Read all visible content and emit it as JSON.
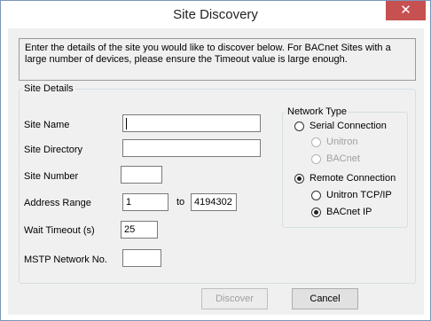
{
  "window": {
    "title": "Site Discovery",
    "close_glyph": "✕"
  },
  "intro_text": "Enter the details of the site you would like to discover below. For BACnet Sites with a large number of devices, please ensure the Timeout value is large enough.",
  "site_details": {
    "legend": "Site Details",
    "site_name": {
      "label": "Site Name",
      "value": ""
    },
    "site_directory": {
      "label": "Site Directory",
      "value": ""
    },
    "site_number": {
      "label": "Site Number",
      "value": ""
    },
    "address_range": {
      "label": "Address Range",
      "from": "1",
      "to_label": "to",
      "to": "4194302"
    },
    "wait_timeout": {
      "label": "Wait Timeout (s)",
      "value": "25"
    },
    "mstp_network": {
      "label": "MSTP Network No.",
      "value": ""
    }
  },
  "network_type": {
    "legend": "Network Type",
    "serial": {
      "label": "Serial Connection",
      "checked": false
    },
    "serial_unitron": {
      "label": "Unitron",
      "checked": false,
      "disabled": true
    },
    "serial_bacnet": {
      "label": "BACnet",
      "checked": false,
      "disabled": true
    },
    "remote": {
      "label": "Remote Connection",
      "checked": true
    },
    "remote_unitron": {
      "label": "Unitron TCP/IP",
      "checked": false
    },
    "remote_bacnet": {
      "label": "BACnet IP",
      "checked": true
    }
  },
  "buttons": {
    "discover": "Discover",
    "cancel": "Cancel"
  }
}
